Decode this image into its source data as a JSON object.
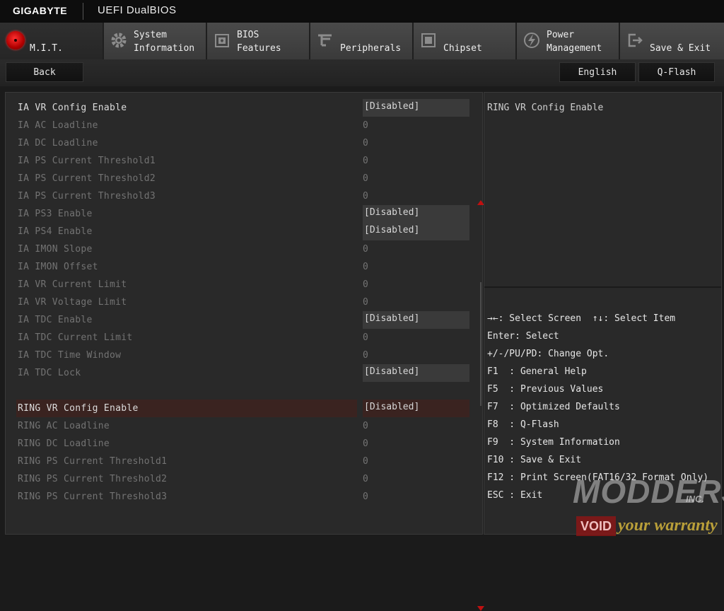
{
  "window": {
    "brand": "GIGABYTE",
    "title": "UEFI DualBIOS"
  },
  "tabs": [
    {
      "line1": "",
      "line2": "M.I.T.",
      "icon": "mit-icon",
      "active": true
    },
    {
      "line1": "System",
      "line2": "Information",
      "icon": "gear-icon"
    },
    {
      "line1": "BIOS",
      "line2": "Features",
      "icon": "bios-features-icon"
    },
    {
      "line1": "",
      "line2": "Peripherals",
      "icon": "peripherals-icon"
    },
    {
      "line1": "",
      "line2": "Chipset",
      "icon": "chipset-icon"
    },
    {
      "line1": "Power",
      "line2": "Management",
      "icon": "power-icon"
    },
    {
      "line1": "",
      "line2": "Save & Exit",
      "icon": "exit-icon"
    }
  ],
  "buttons": {
    "back": "Back",
    "language": "English",
    "qflash": "Q-Flash"
  },
  "settings": [
    {
      "label": "IA VR Config Enable",
      "value": "[Disabled]",
      "boxed": true,
      "state": "bright"
    },
    {
      "label": "IA AC Loadline",
      "value": "0",
      "state": "dim"
    },
    {
      "label": "IA DC Loadline",
      "value": "0",
      "state": "dim"
    },
    {
      "label": "IA PS Current Threshold1",
      "value": "0",
      "state": "dim"
    },
    {
      "label": "IA PS Current Threshold2",
      "value": "0",
      "state": "dim"
    },
    {
      "label": "IA PS Current Threshold3",
      "value": "0",
      "state": "dim"
    },
    {
      "label": "IA PS3 Enable",
      "value": "[Disabled]",
      "boxed": true,
      "state": "dim"
    },
    {
      "label": "IA PS4 Enable",
      "value": "[Disabled]",
      "boxed": true,
      "state": "dim"
    },
    {
      "label": "IA IMON Slope",
      "value": "0",
      "state": "dim"
    },
    {
      "label": "IA IMON Offset",
      "value": "0",
      "state": "dim"
    },
    {
      "label": "IA VR Current Limit",
      "value": "0",
      "state": "dim"
    },
    {
      "label": "IA VR Voltage Limit",
      "value": "0",
      "state": "dim"
    },
    {
      "label": "IA TDC Enable",
      "value": "[Disabled]",
      "boxed": true,
      "state": "dim"
    },
    {
      "label": "IA TDC Current Limit",
      "value": "0",
      "state": "dim"
    },
    {
      "label": "IA TDC Time Window",
      "value": "0",
      "state": "dim"
    },
    {
      "label": "IA TDC Lock",
      "value": "[Disabled]",
      "boxed": true,
      "state": "dim"
    },
    {
      "label": "RING VR Config Enable",
      "value": "[Disabled]",
      "boxed": true,
      "state": "selected"
    },
    {
      "label": "RING AC Loadline",
      "value": "0",
      "state": "dim"
    },
    {
      "label": "RING DC Loadline",
      "value": "0",
      "state": "dim"
    },
    {
      "label": "RING PS Current Threshold1",
      "value": "0",
      "state": "dim"
    },
    {
      "label": "RING PS Current Threshold2",
      "value": "0",
      "state": "dim"
    },
    {
      "label": "RING PS Current Threshold3",
      "value": "0",
      "state": "dim"
    }
  ],
  "help": {
    "title": "RING VR Config Enable",
    "keys": [
      "→←: Select Screen  ↑↓: Select Item",
      "Enter: Select",
      "+/-/PU/PD: Change Opt.",
      "F1  : General Help",
      "F5  : Previous Values",
      "F7  : Optimized Defaults",
      "F8  : Q-Flash",
      "F9  : System Information",
      "F10 : Save & Exit",
      "F12 : Print Screen(FAT16/32 Format Only)",
      "ESC : Exit"
    ]
  },
  "watermark": {
    "line1": "MODDERS",
    "line2": "INC.",
    "void": "VOID",
    "tagline": "your warranty"
  },
  "colors": {
    "accent": "#c01010",
    "selected_row": "#3a2320",
    "panel": "#292929"
  }
}
